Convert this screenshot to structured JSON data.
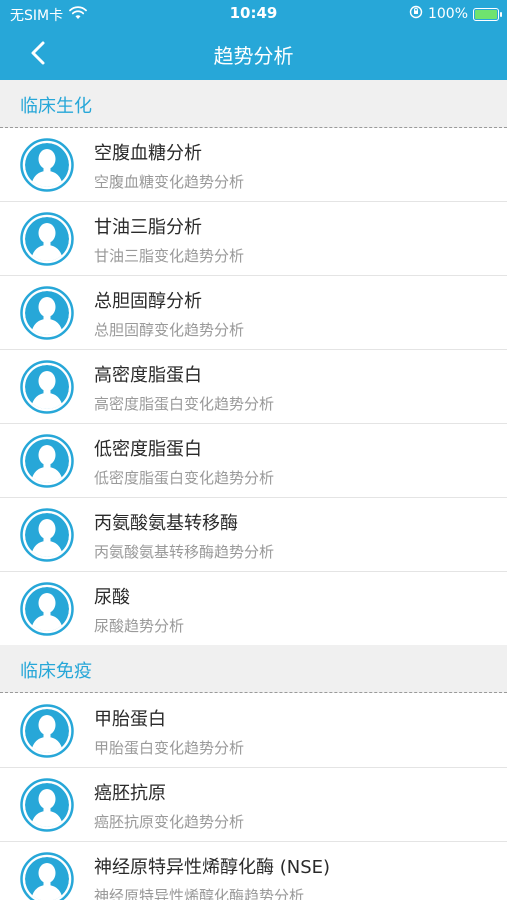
{
  "status_bar": {
    "carrier": "无SIM卡",
    "time": "10:49",
    "battery": "100%",
    "battery_level": 1.0
  },
  "nav": {
    "title": "趋势分析",
    "back_icon": "chevron-left-icon"
  },
  "sections": [
    {
      "title": "临床生化",
      "items": [
        {
          "title": "空腹血糖分析",
          "subtitle": "空腹血糖变化趋势分析"
        },
        {
          "title": "甘油三脂分析",
          "subtitle": "甘油三脂变化趋势分析"
        },
        {
          "title": "总胆固醇分析",
          "subtitle": "总胆固醇变化趋势分析"
        },
        {
          "title": "高密度脂蛋白",
          "subtitle": "高密度脂蛋白变化趋势分析"
        },
        {
          "title": "低密度脂蛋白",
          "subtitle": "低密度脂蛋白变化趋势分析"
        },
        {
          "title": "丙氨酸氨基转移酶",
          "subtitle": "丙氨酸氨基转移酶趋势分析"
        },
        {
          "title": "尿酸",
          "subtitle": "尿酸趋势分析"
        }
      ]
    },
    {
      "title": "临床免疫",
      "items": [
        {
          "title": "甲胎蛋白",
          "subtitle": "甲胎蛋白变化趋势分析"
        },
        {
          "title": "癌胚抗原",
          "subtitle": "癌胚抗原变化趋势分析"
        },
        {
          "title": "神经原特异性烯醇化酶 (NSE)",
          "subtitle": "神经原特异性烯醇化酶趋势分析"
        }
      ]
    }
  ],
  "colors": {
    "accent": "#27a7d8",
    "section_bg": "#f0f0f0",
    "title_text": "#2a2a2a",
    "subtitle_text": "#9a9a9a"
  },
  "icons": {
    "avatar": "user-avatar-icon",
    "wifi": "wifi-icon",
    "lock_rotation": "orientation-lock-icon",
    "battery": "battery-icon"
  }
}
